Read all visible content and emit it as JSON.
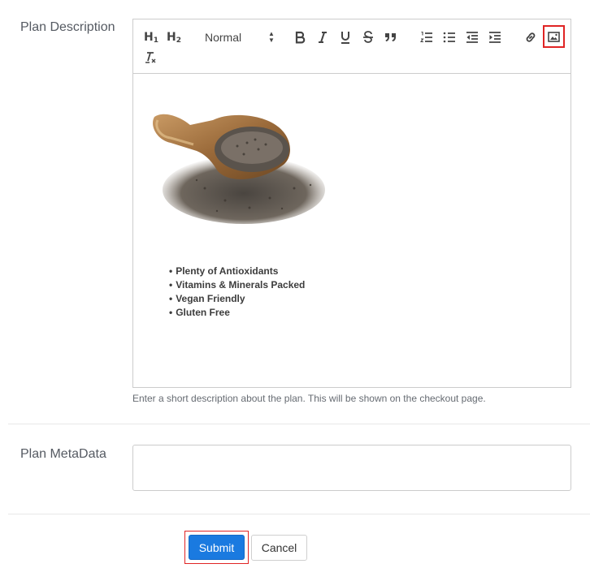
{
  "form": {
    "description_label": "Plan Description",
    "description_help": "Enter a short description about the plan. This will be shown on the checkout page.",
    "metadata_label": "Plan MetaData",
    "metadata_value": "",
    "submit_label": "Submit",
    "cancel_label": "Cancel"
  },
  "toolbar": {
    "h1_label": "H",
    "h1_sub": "1",
    "h2_label": "H",
    "h2_sub": "2",
    "format_selected": "Normal",
    "icons": [
      "header-1-icon",
      "header-2-icon",
      "format-picker",
      "bold-icon",
      "italic-icon",
      "underline-icon",
      "strike-icon",
      "blockquote-icon",
      "ordered-list-icon",
      "bullet-list-icon",
      "outdent-icon",
      "indent-icon",
      "link-icon",
      "image-icon",
      "clean-format-icon"
    ],
    "highlighted": "image-icon"
  },
  "editor_content": {
    "image": "chia-seeds-in-wooden-scoop",
    "bullets": [
      "Plenty of Antioxidants",
      "Vitamins & Minerals Packed",
      "Vegan Friendly",
      "Gluten Free"
    ]
  },
  "colors": {
    "primary": "#1a7ae0",
    "highlight": "#e02424",
    "border": "#cccccc",
    "label": "#555a62"
  }
}
